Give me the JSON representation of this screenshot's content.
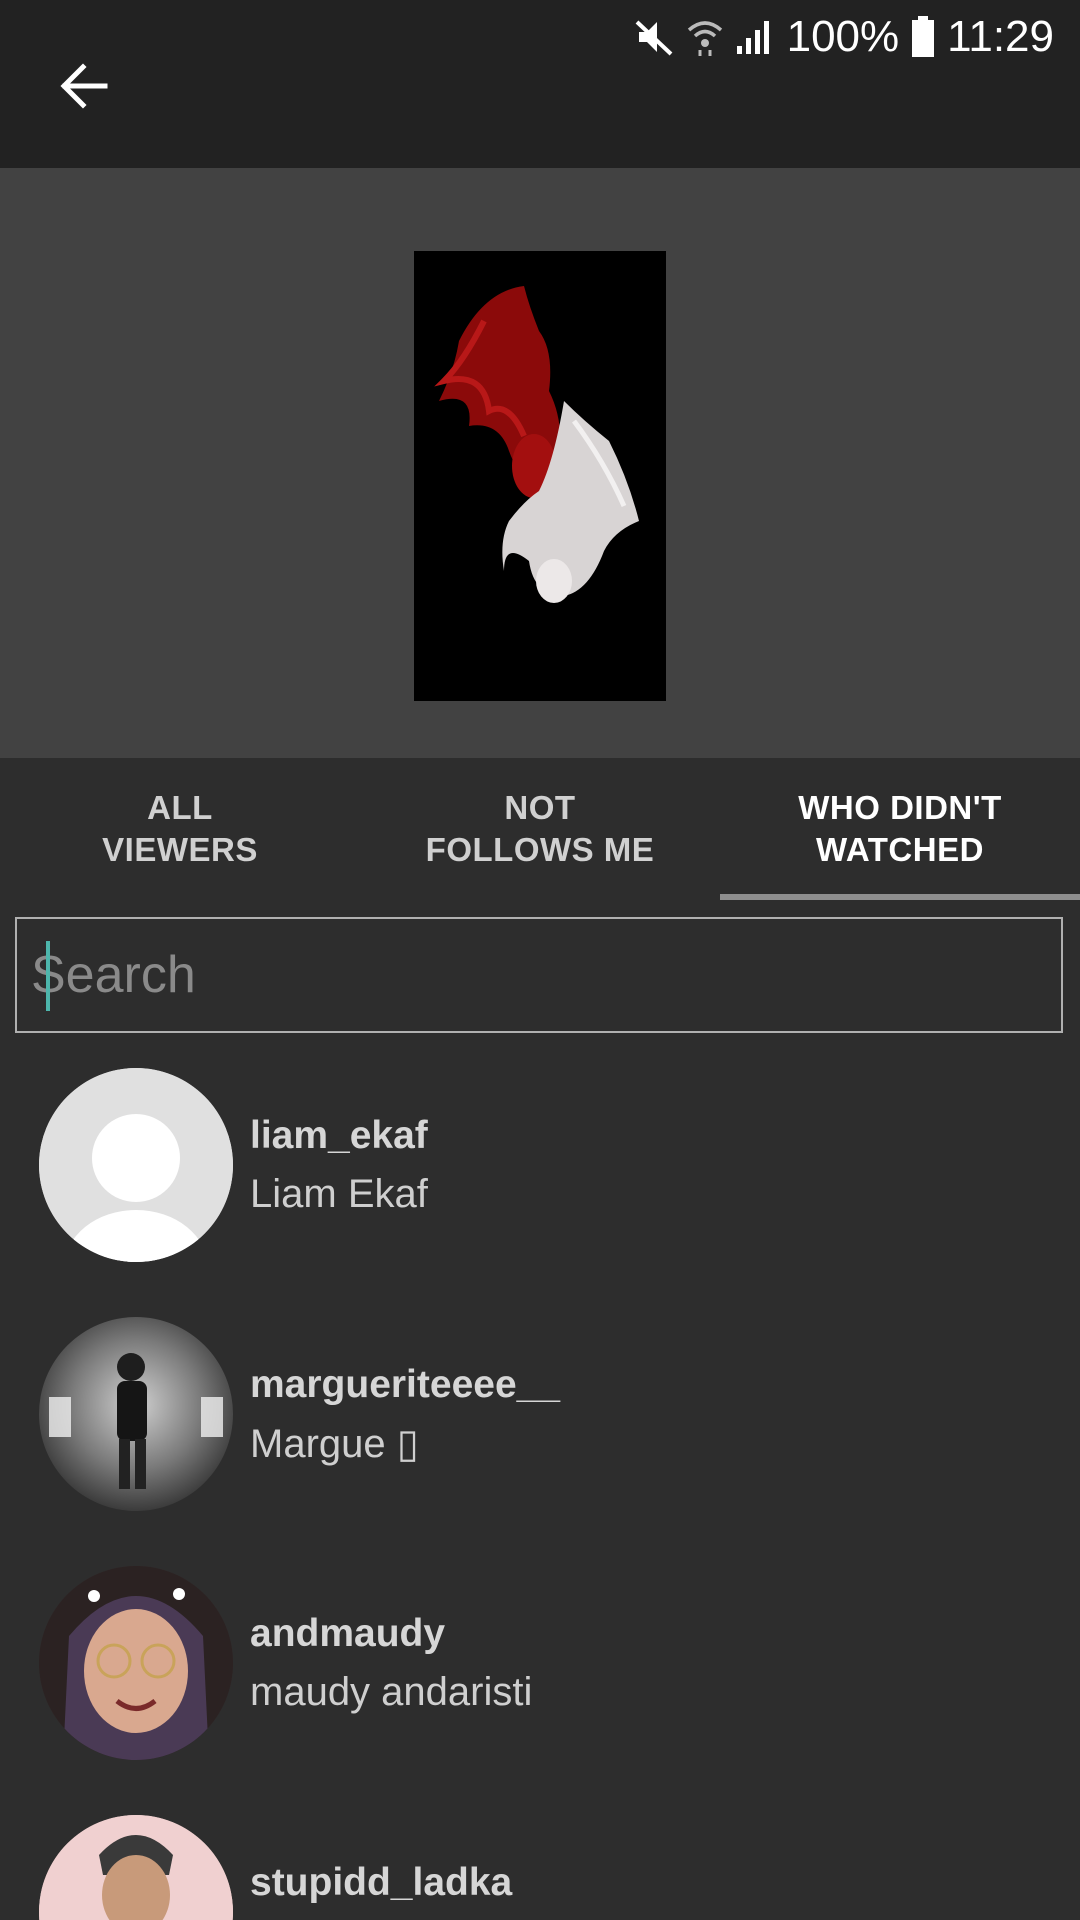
{
  "status_bar": {
    "battery": "100%",
    "time": "11:29",
    "icons": [
      "mute-icon",
      "wifi-icon",
      "signal-icon",
      "battery-icon"
    ]
  },
  "header": {
    "back_icon": "arrow-left-icon"
  },
  "tabs": [
    {
      "label": "ALL\nVIEWERS",
      "active": false
    },
    {
      "label": "NOT\nFOLLOWS ME",
      "active": false
    },
    {
      "label": "WHO DIDN'T\nWATCHED",
      "active": true
    }
  ],
  "search": {
    "placeholder": "Search",
    "value": ""
  },
  "users": [
    {
      "username": "liam_ekaf",
      "full_name": "Liam Ekaf",
      "avatar": "default-avatar"
    },
    {
      "username": "margueriteeee__",
      "full_name": "Margue ▯",
      "avatar": "photo"
    },
    {
      "username": "andmaudy",
      "full_name": "maudy andaristi",
      "avatar": "photo"
    },
    {
      "username": "stupidd_ladka",
      "full_name": "",
      "avatar": "photo"
    }
  ],
  "colors": {
    "status_bg": "#222222",
    "preview_bg": "#424242",
    "page_bg": "#2d2d2d",
    "caret": "#4db6ac"
  }
}
